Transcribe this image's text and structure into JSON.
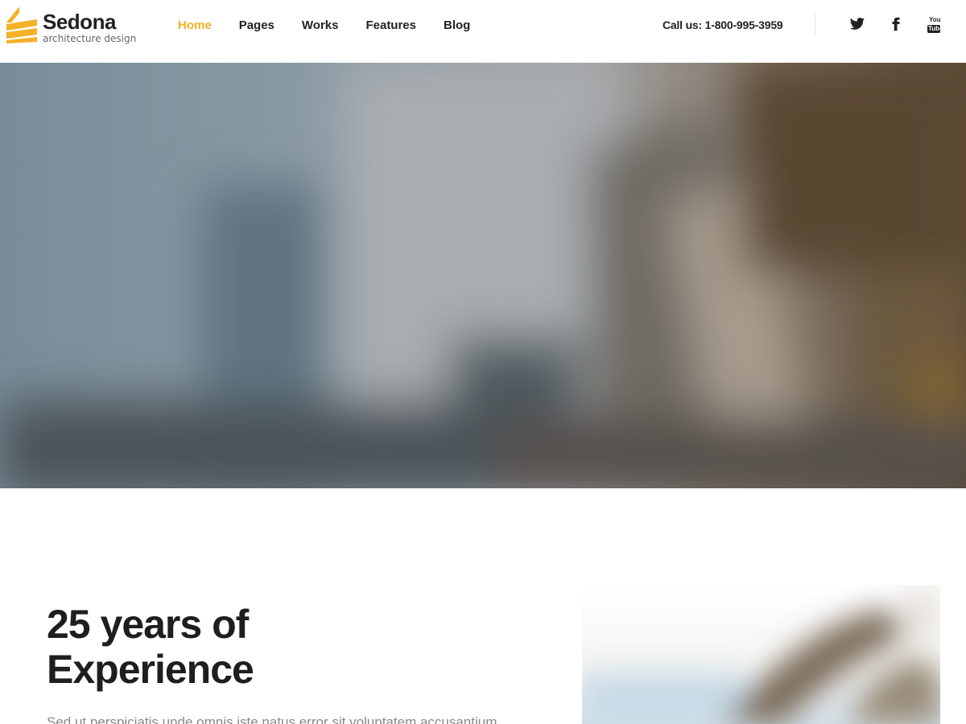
{
  "brand": {
    "name": "Sedona",
    "tagline": "architecture design",
    "accent_color": "#f5b026"
  },
  "nav": {
    "items": [
      {
        "label": "Home",
        "active": true
      },
      {
        "label": "Pages",
        "active": false
      },
      {
        "label": "Works",
        "active": false
      },
      {
        "label": "Features",
        "active": false
      },
      {
        "label": "Blog",
        "active": false
      }
    ]
  },
  "contact": {
    "call_text": "Call us: 1-800-995-3959"
  },
  "social": [
    {
      "icon": "twitter-icon"
    },
    {
      "icon": "facebook-icon"
    },
    {
      "icon": "youtube-icon",
      "text_top": "You",
      "text_bottom": "Tube"
    }
  ],
  "hero": {
    "image": "blurred-city-skyline"
  },
  "about": {
    "title_line1": "25 years of",
    "title_line2": "Experience",
    "text": "Sed ut perspiciatis unde omnis iste natus error sit voluptatem accusantium",
    "image": "blurred-architecture-photo"
  }
}
